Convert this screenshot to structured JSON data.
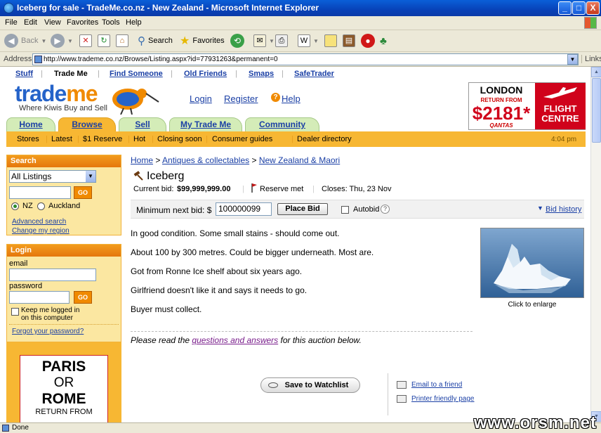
{
  "window": {
    "title": "Iceberg for sale - TradeMe.co.nz - New Zealand - Microsoft Internet Explorer",
    "min_label": "_",
    "max_label": "□",
    "close_label": "X"
  },
  "menu": [
    "File",
    "Edit",
    "View",
    "Favorites",
    "Tools",
    "Help"
  ],
  "toolbar": {
    "back_label": "Back",
    "search_label": "Search",
    "favorites_label": "Favorites"
  },
  "address": {
    "label": "Address",
    "url": "http://www.trademe.co.nz/Browse/Listing.aspx?id=77931263&permanent=0",
    "links_label": "Links"
  },
  "status": {
    "text": "Done",
    "watermark": "www.orsm.net"
  },
  "site": {
    "top_links": [
      "Stuff",
      "Trade Me",
      "Find Someone",
      "Old Friends",
      "Smaps",
      "SafeTrader"
    ],
    "logo_part1": "trade",
    "logo_part2": "me",
    "tagline": "Where Kiwis Buy and Sell",
    "login_link": "Login",
    "register_link": "Register",
    "help_link": "Help",
    "ad_top": {
      "line1": "LONDON",
      "line2": "RETURN FROM",
      "price": "$2181*",
      "airline": "QANTAS",
      "brand": "FLIGHT CENTRE"
    },
    "tabs": [
      "Home",
      "Browse",
      "Sell",
      "My Trade Me",
      "Community"
    ],
    "active_tab": "Browse",
    "subnav": [
      "Stores",
      "Latest",
      "$1 Reserve",
      "Hot",
      "Closing soon",
      "Consumer guides",
      "Dealer directory"
    ],
    "time": "4:04 pm"
  },
  "search_panel": {
    "heading": "Search",
    "category": "All Listings",
    "go_label": "GO",
    "radio_nz": "NZ",
    "radio_auckland": "Auckland",
    "advanced_link": "Advanced search",
    "region_link": "Change my region"
  },
  "login_panel": {
    "heading": "Login",
    "email_label": "email",
    "password_label": "password",
    "go_label": "GO",
    "keep_label": "Keep me logged in",
    "keep_label2": "on this computer",
    "forgot_link": "Forgot your password?"
  },
  "ad_left": {
    "line1": "PARIS",
    "line2": "OR",
    "line3": "ROME",
    "line4": "RETURN FROM"
  },
  "listing": {
    "breadcrumb": [
      "Home",
      "Antiques & collectables",
      "New Zealand & Maori"
    ],
    "breadcrumb_sep": ">",
    "title": "Iceberg",
    "current_bid_label": "Current bid:",
    "current_bid": "$99,999,999.00",
    "reserve": "Reserve met",
    "closes": "Closes: Thu, 23 Nov",
    "min_bid_label": "Minimum next bid: $",
    "min_bid_value": "100000099",
    "place_bid": "Place Bid",
    "autobid": "Autobid",
    "autobid_help": "?",
    "bid_history": "Bid history",
    "description": [
      "In good condition. Some small stains - should come out.",
      "About 100 by 300 metres. Could be bigger underneath. Most are.",
      "Got from Ronne Ice shelf about six years ago.",
      "Girlfriend doesn't like it and says it needs to go.",
      "Buyer must collect."
    ],
    "enlarge": "Click to enlarge",
    "qna_pre": "Please read the ",
    "qna_link": "questions and answers",
    "qna_post": " for this auction below.",
    "watchlist": "Save to Watchlist",
    "email_friend": "Email to a friend",
    "printer": "Printer friendly page"
  }
}
